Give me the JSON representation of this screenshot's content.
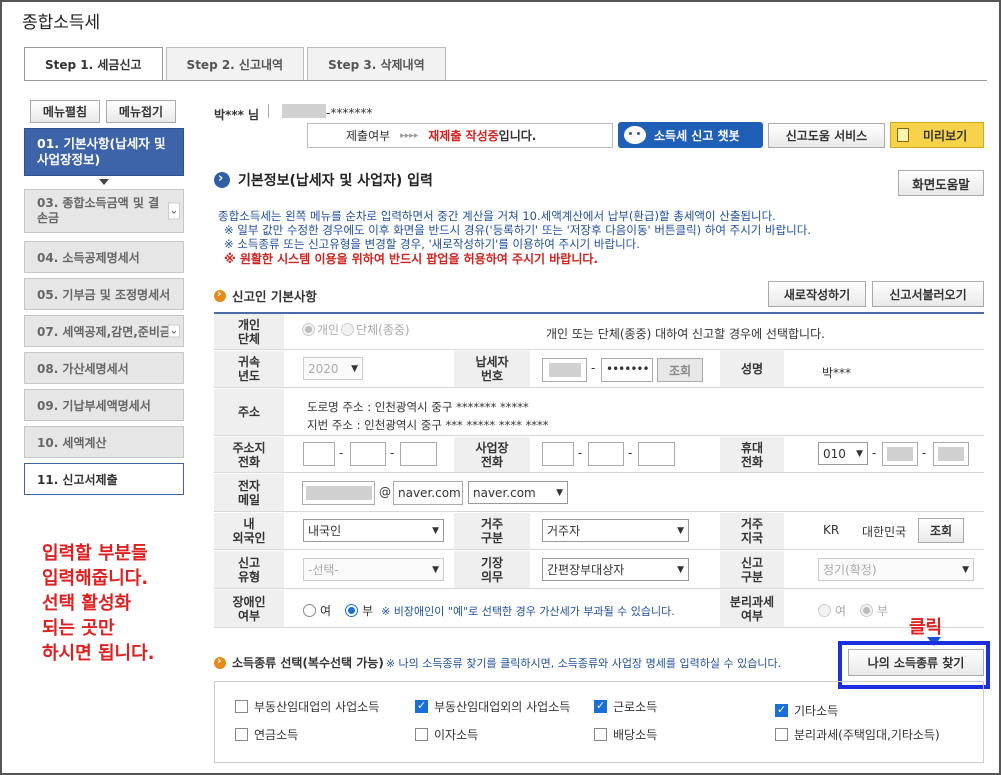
{
  "page": {
    "title": "종합소득세"
  },
  "tabs": [
    "Step 1. 세금신고",
    "Step 2. 신고내역",
    "Step 3. 삭제내역"
  ],
  "sidebar": {
    "expand": "메뉴펼침",
    "collapse": "메뉴접기",
    "items": [
      {
        "label": "01. 기본사항(납세자 및 사업장정보)"
      },
      {
        "label": "03. 종합소득금액 및 결손금"
      },
      {
        "label": "04. 소득공제명세서"
      },
      {
        "label": "05. 기부금 및 조정명세서"
      },
      {
        "label": "07. 세액공제,감면,준비금"
      },
      {
        "label": "08. 가산세명세서"
      },
      {
        "label": "09. 기납부세액명세서"
      },
      {
        "label": "10. 세액계산"
      },
      {
        "label": "11. 신고서제출"
      }
    ]
  },
  "annotation": {
    "lines": [
      "입력할 부분들",
      "입력해줍니다.",
      "선택 활성화",
      "되는 곳만",
      "하시면 됩니다."
    ],
    "click_label": "클릭"
  },
  "user": {
    "name": "박*** 님",
    "id_masked": "-*******"
  },
  "status": {
    "label": "제출여부",
    "arrows": "▸▸▸▸",
    "value_red": "재제출 작성중",
    "value_suffix": "입니다."
  },
  "top_buttons": {
    "chatbot": "소득세 신고 챗봇",
    "help_service": "신고도움 서비스",
    "preview": "미리보기"
  },
  "section_title": "기본정보(납세자 및 사업자) 입력",
  "screen_help": "화면도움말",
  "info": {
    "line1": "종합소득세는 왼쪽 메뉴를 순차로 입력하면서 중간 계산을 거쳐 10.세액계산에서 납부(환급)할 총세액이 산출됩니다.",
    "line2": "※ 일부 값만 수정한 경우에도 이후 화면을 반드시 경유('등록하기' 또는 '저장후 다음이동' 버튼클릭) 하여 주시기 바랍니다.",
    "line3": "※ 소득종류 또는 신고유형을 변경할 경우, '새로작성하기'를 이용하여 주시기 바랍니다.",
    "warning": "※ 원활한 시스템 이용을 위하여 반드시 팝업을 허용하여 주시기 바랍니다."
  },
  "basic": {
    "title": "신고인 기본사항",
    "new_button": "새로작성하기",
    "load_button": "신고서불러오기",
    "individual_label": "개인\n단체",
    "individual_opt1": "개인",
    "individual_opt2": "단체(종중)",
    "individual_note": "개인 또는 단체(종중) 대하여 신고할 경우에 선택합니다.",
    "year_label": "귀속\n년도",
    "year_value": "2020",
    "taxpayer_no_label": "납세자\n번호",
    "taxpayer_no_masked": "•••••••",
    "lookup": "조회",
    "name_label": "성명",
    "name_value": "박***",
    "address_label": "주소",
    "road_address": "도로명 주소 :   인천광역시 중구 ******* *****",
    "lot_address": "지번 주소 :   인천광역시 중구 *** ***** **** ****",
    "home_phone_label": "주소지\n전화",
    "biz_phone_label": "사업장\n전화",
    "mobile_label": "휴대\n전화",
    "mobile_prefix": "010",
    "email_label": "전자\n메일",
    "email_at": "@",
    "email_domain": "naver.com",
    "email_select": "naver.com",
    "foreigner_label": "내\n외국인",
    "foreigner_value": "내국인",
    "residence_label": "거주\n구분",
    "residence_value": "거주자",
    "country_label": "거주\n지국",
    "country_code": "KR",
    "country_name": "대한민국",
    "report_type_label": "신고\n유형",
    "report_type_value": "-선택-",
    "bookkeeping_label": "기장\n의무",
    "bookkeeping_value": "간편장부대상자",
    "report_div_label": "신고\n구분",
    "report_div_value": "정기(확정)",
    "disabled_label": "장애인\n여부",
    "yes": "여",
    "no": "부",
    "disabled_note": "※ 비장애인이 \"예\"로 선택한 경우 가산세가 부과될 수 있습니다.",
    "separate_label": "분리과세\n여부"
  },
  "income": {
    "title": "소득종류 선택(복수선택 가능)",
    "note": "※ 나의 소득종류 찾기를 클릭하시면, 소득종류와 사업장 명세를 입력하실 수 있습니다.",
    "find_button": "나의 소득종류 찾기",
    "options": [
      {
        "label": "부동산임대업의 사업소득",
        "checked": false
      },
      {
        "label": "부동산임대업외의 사업소득",
        "checked": true
      },
      {
        "label": "근로소득",
        "checked": true
      },
      {
        "label": "기타소득",
        "checked": true
      },
      {
        "label": "연금소득",
        "checked": false
      },
      {
        "label": "이자소득",
        "checked": false
      },
      {
        "label": "배당소득",
        "checked": false
      },
      {
        "label": "분리과세(주택임대,기타소득)",
        "checked": false
      }
    ]
  }
}
